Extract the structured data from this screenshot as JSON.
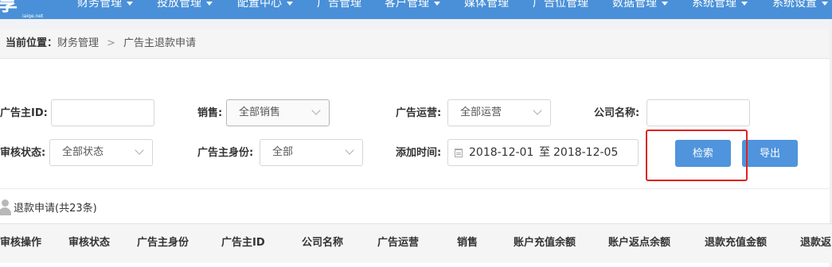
{
  "nav": {
    "logo": "享",
    "logo_small": "iaiqe.net",
    "items": [
      {
        "label": "财务管理",
        "dropdown": true
      },
      {
        "label": "投放管理",
        "dropdown": true
      },
      {
        "label": "配置中心",
        "dropdown": true
      },
      {
        "label": "广告管理",
        "dropdown": false
      },
      {
        "label": "客户管理",
        "dropdown": true
      },
      {
        "label": "媒体管理",
        "dropdown": false
      },
      {
        "label": "广告位管理",
        "dropdown": false
      },
      {
        "label": "数据管理",
        "dropdown": true
      },
      {
        "label": "系统管理",
        "dropdown": true
      },
      {
        "label": "系统设置",
        "dropdown": true
      }
    ]
  },
  "breadcrumb": {
    "prefix": "当前位置：",
    "level1": "财务管理",
    "separator": ">",
    "level2": "广告主退款申请"
  },
  "filters": {
    "advertiser_id": {
      "label": "广告主ID:",
      "value": ""
    },
    "sales": {
      "label": "销售:",
      "value": "全部销售"
    },
    "ad_operation": {
      "label": "广告运营:",
      "value": "全部运营"
    },
    "company_name": {
      "label": "公司名称:",
      "value": ""
    },
    "review_status": {
      "label": "审核状态:",
      "value": "全部状态"
    },
    "advertiser_identity": {
      "label": "广告主身份:",
      "value": "全部"
    },
    "add_time": {
      "label": "添加时间:",
      "start": "2018-12-01",
      "to": "至",
      "end": "2018-12-05"
    }
  },
  "buttons": {
    "search": "检索",
    "export": "导出"
  },
  "list": {
    "title": "退款申请(共23条)",
    "columns": [
      "审核操作",
      "审核状态",
      "广告主身份",
      "广告主ID",
      "公司名称",
      "广告运营",
      "销售",
      "账户充值余额",
      "账户返点余额",
      "退款充值金额",
      "退款返"
    ]
  },
  "colors": {
    "nav_bg": "#4a90d8",
    "button_bg": "#4f94dc",
    "highlight_border": "#e02020"
  }
}
